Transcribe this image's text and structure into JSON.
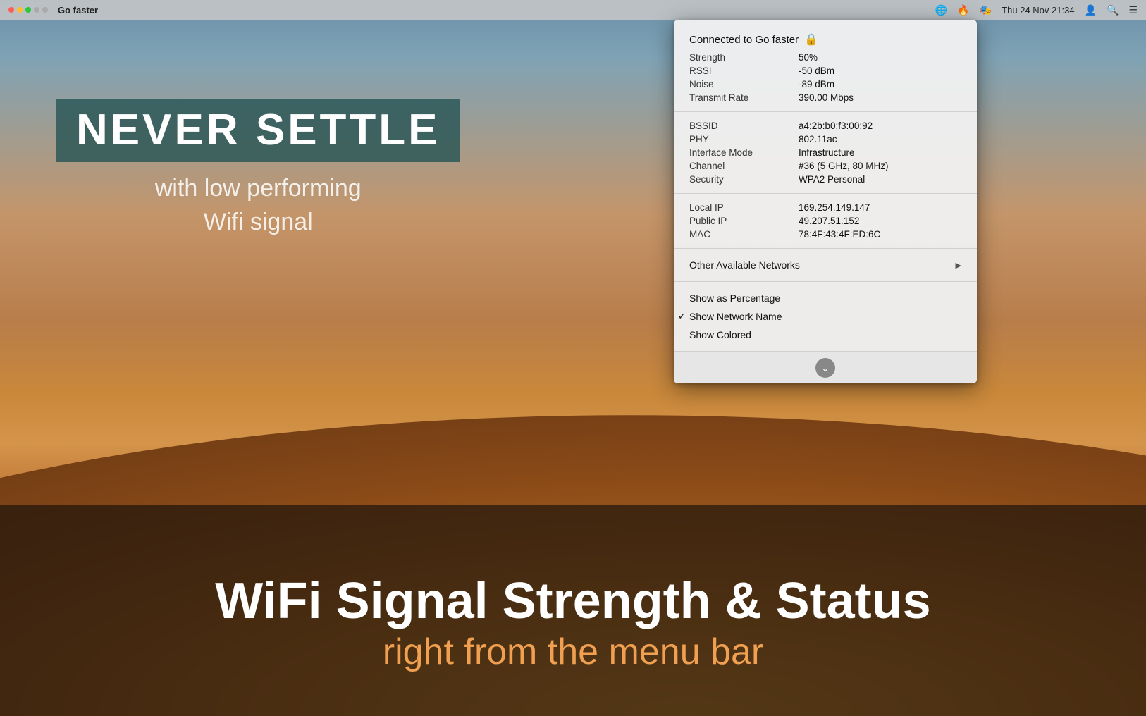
{
  "desktop": {
    "bg_description": "Mojave desert landscape",
    "never_settle": "NEVER SETTLE",
    "subtitle_line1": "with low performing",
    "subtitle_line2": "Wifi signal",
    "bottom_title": "WiFi Signal Strength & Status",
    "bottom_subtitle": "right from the menu bar"
  },
  "menubar": {
    "dots": [
      "red",
      "yellow",
      "green",
      "gray",
      "gray"
    ],
    "app_name": "Go faster",
    "icons": [
      "globe-icon",
      "flame-icon",
      "monster-icon"
    ],
    "datetime": "Thu 24 Nov  21:34",
    "person_icon": "person-icon",
    "search_icon": "search-icon",
    "list_icon": "list-icon"
  },
  "dropdown": {
    "connected_label": "Connected to Go faster",
    "lock_emoji": "🔒",
    "section1": {
      "rows": [
        {
          "label": "Strength",
          "value": "50%"
        },
        {
          "label": "RSSI",
          "value": "-50 dBm"
        },
        {
          "label": "Noise",
          "value": "-89 dBm"
        },
        {
          "label": "Transmit Rate",
          "value": "390.00 Mbps"
        }
      ]
    },
    "section2": {
      "rows": [
        {
          "label": "BSSID",
          "value": "a4:2b:b0:f3:00:92"
        },
        {
          "label": "PHY",
          "value": "802.11ac"
        },
        {
          "label": "Interface Mode",
          "value": "Infrastructure"
        },
        {
          "label": "Channel",
          "value": "#36 (5 GHz, 80 MHz)"
        },
        {
          "label": "Security",
          "value": "WPA2 Personal"
        }
      ]
    },
    "section3": {
      "rows": [
        {
          "label": "Local IP",
          "value": "169.254.149.147"
        },
        {
          "label": "Public IP",
          "value": "49.207.51.152"
        },
        {
          "label": "MAC",
          "value": "78:4F:43:4F:ED:6C"
        }
      ]
    },
    "other_networks_label": "Other Available Networks",
    "menu_items": [
      {
        "label": "Show as Percentage",
        "checked": false
      },
      {
        "label": "Show Network Name",
        "checked": true
      },
      {
        "label": "Show Colored",
        "checked": false
      }
    ],
    "scroll_down_label": "⌄"
  }
}
